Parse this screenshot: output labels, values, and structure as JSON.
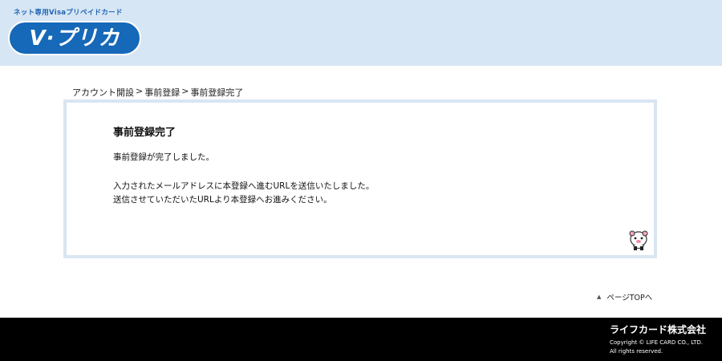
{
  "header": {
    "tagline": "ネット専用Visaプリペイドカード",
    "logo_text": "V·プリカ"
  },
  "breadcrumb": {
    "items": [
      "アカウント開設",
      "事前登録",
      "事前登録完了"
    ],
    "separator": ">"
  },
  "panel": {
    "title": "事前登録完了",
    "message1": "事前登録が完了しました。",
    "message2": "入力されたメールアドレスに本登録へ進むURLを送信いたしました。",
    "message3": "送信させていただいたURLより本登録へお進みください。"
  },
  "pagetop": {
    "label": "ページTOPへ",
    "icon": "chevron-up-icon"
  },
  "footer": {
    "company": "ライフカード株式会社",
    "copyright1": "Copyright © LIFE CARD CO., LTD.",
    "copyright2": "All rights reserved."
  },
  "colors": {
    "header_bg": "#d6e6f4",
    "logo_blue": "#1668b8",
    "panel_border": "#d8e6f2",
    "footer_bg": "#000000"
  }
}
